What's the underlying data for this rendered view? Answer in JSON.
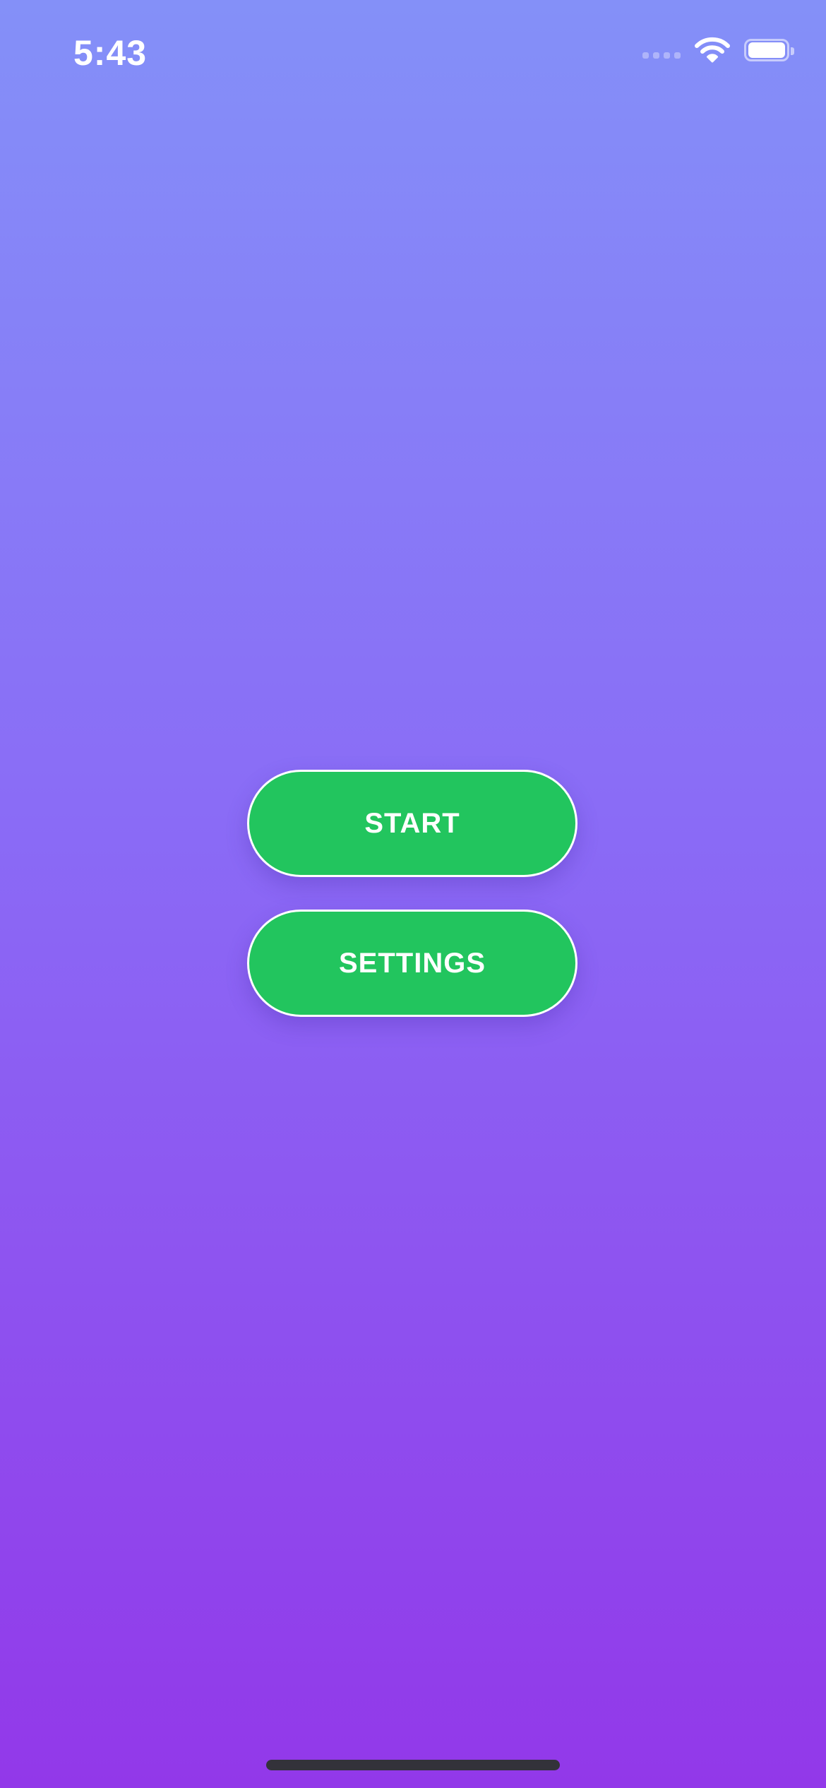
{
  "status_bar": {
    "time": "5:43",
    "icons": [
      "cellular-signal-icon",
      "wifi-icon",
      "battery-icon"
    ],
    "battery_level_percent": 100
  },
  "menu": {
    "start_label": "START",
    "settings_label": "SETTINGS"
  },
  "colors": {
    "background_top": "#8490f8",
    "background_bottom": "#9238e9",
    "button_fill": "#22c55e",
    "button_border": "#ffffff",
    "button_text": "#ffffff",
    "home_indicator": "#33323a"
  }
}
